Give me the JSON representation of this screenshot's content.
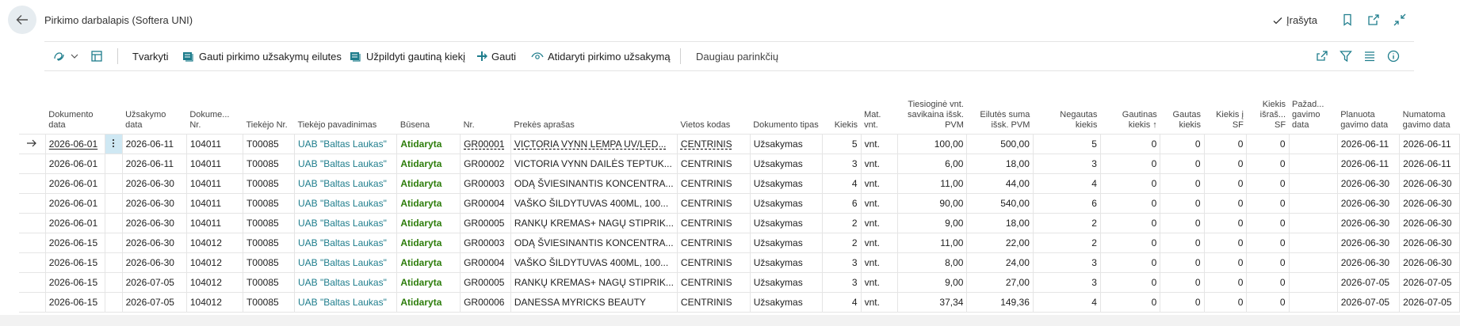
{
  "header": {
    "title": "Pirkimo darbalapis (Softera UNI)",
    "saved_label": "Įrašyta"
  },
  "toolbar": {
    "actions": [
      "Tvarkyti",
      "Gauti pirkimo užsakymų eilutes",
      "Užpildyti gautiną kiekį",
      "Gauti",
      "Atidaryti pirkimo užsakymą",
      "Daugiau parinkčių"
    ]
  },
  "columns": [
    "Dokumento data",
    "Užsakymo data",
    "Dokume... Nr.",
    "Tiekėjo Nr.",
    "Tiekėjo pavadinimas",
    "Būsena",
    "Nr.",
    "Prekės aprašas",
    "Vietos kodas",
    "Dokumento tipas",
    "Kiekis",
    "Mat. vnt.",
    "Tiesioginė vnt. savikaina išsk. PVM",
    "Eilutės suma išsk. PVM",
    "Negautas kiekis",
    "Gautinas kiekis ↑",
    "Gautas kiekis",
    "Kiekis į SF",
    "Kiekis išraš... SF",
    "Pažad... gavimo data",
    "Planuota gavimo data",
    "Numatoma gavimo data"
  ],
  "rows": [
    [
      "2026-06-01",
      "2026-06-11",
      "104011",
      "T00085",
      "UAB \"Baltas Laukas\"",
      "Atidaryta",
      "GR00001",
      "VICTORIA VYNN LEMPA UV/LED...",
      "CENTRINIS",
      "Užsakymas",
      "5",
      "vnt.",
      "100,00",
      "500,00",
      "5",
      "0",
      "0",
      "0",
      "0",
      "",
      "2026-06-11",
      "2026-06-11"
    ],
    [
      "2026-06-01",
      "2026-06-11",
      "104011",
      "T00085",
      "UAB \"Baltas Laukas\"",
      "Atidaryta",
      "GR00002",
      "VICTORIA VYNN DAILĖS TEPTUK...",
      "CENTRINIS",
      "Užsakymas",
      "3",
      "vnt.",
      "6,00",
      "18,00",
      "3",
      "0",
      "0",
      "0",
      "0",
      "",
      "2026-06-11",
      "2026-06-11"
    ],
    [
      "2026-06-01",
      "2026-06-30",
      "104011",
      "T00085",
      "UAB \"Baltas Laukas\"",
      "Atidaryta",
      "GR00003",
      "ODĄ ŠVIESINANTIS KONCENTRA...",
      "CENTRINIS",
      "Užsakymas",
      "4",
      "vnt.",
      "11,00",
      "44,00",
      "4",
      "0",
      "0",
      "0",
      "0",
      "",
      "2026-06-30",
      "2026-06-30"
    ],
    [
      "2026-06-01",
      "2026-06-30",
      "104011",
      "T00085",
      "UAB \"Baltas Laukas\"",
      "Atidaryta",
      "GR00004",
      "VAŠKO ŠILDYTUVAS 400ML, 100...",
      "CENTRINIS",
      "Užsakymas",
      "6",
      "vnt.",
      "90,00",
      "540,00",
      "6",
      "0",
      "0",
      "0",
      "0",
      "",
      "2026-06-30",
      "2026-06-30"
    ],
    [
      "2026-06-01",
      "2026-06-30",
      "104011",
      "T00085",
      "UAB \"Baltas Laukas\"",
      "Atidaryta",
      "GR00005",
      "RANKŲ KREMAS+ NAGŲ STIPRIK...",
      "CENTRINIS",
      "Užsakymas",
      "2",
      "vnt.",
      "9,00",
      "18,00",
      "2",
      "0",
      "0",
      "0",
      "0",
      "",
      "2026-06-30",
      "2026-06-30"
    ],
    [
      "2026-06-15",
      "2026-06-30",
      "104012",
      "T00085",
      "UAB \"Baltas Laukas\"",
      "Atidaryta",
      "GR00003",
      "ODĄ ŠVIESINANTIS KONCENTRA...",
      "CENTRINIS",
      "Užsakymas",
      "2",
      "vnt.",
      "11,00",
      "22,00",
      "2",
      "0",
      "0",
      "0",
      "0",
      "",
      "2026-06-30",
      "2026-06-30"
    ],
    [
      "2026-06-15",
      "2026-06-30",
      "104012",
      "T00085",
      "UAB \"Baltas Laukas\"",
      "Atidaryta",
      "GR00004",
      "VAŠKO ŠILDYTUVAS 400ML, 100...",
      "CENTRINIS",
      "Užsakymas",
      "3",
      "vnt.",
      "8,00",
      "24,00",
      "3",
      "0",
      "0",
      "0",
      "0",
      "",
      "2026-06-30",
      "2026-06-30"
    ],
    [
      "2026-06-15",
      "2026-07-05",
      "104012",
      "T00085",
      "UAB \"Baltas Laukas\"",
      "Atidaryta",
      "GR00005",
      "RANKŲ KREMAS+ NAGŲ STIPRIK...",
      "CENTRINIS",
      "Užsakymas",
      "3",
      "vnt.",
      "9,00",
      "27,00",
      "3",
      "0",
      "0",
      "0",
      "0",
      "",
      "2026-07-05",
      "2026-07-05"
    ],
    [
      "2026-06-15",
      "2026-07-05",
      "104012",
      "T00085",
      "UAB \"Baltas Laukas\"",
      "Atidaryta",
      "GR00006",
      "DANESSA MYRICKS BEAUTY",
      "CENTRINIS",
      "Užsakymas",
      "4",
      "vnt.",
      "37,34",
      "149,36",
      "4",
      "0",
      "0",
      "0",
      "0",
      "",
      "2026-07-05",
      "2026-07-05"
    ]
  ],
  "icons": {
    "back": "arrow-left-icon",
    "saved": "checkmark-icon",
    "bookmark": "bookmark-icon",
    "open_new": "open-in-new-window-icon",
    "collapse": "collapse-icon",
    "share": "share-icon",
    "filter": "filter-icon",
    "list": "list-icon",
    "info": "info-icon",
    "row_arrow": "current-row-arrow-icon",
    "row_menu": "row-menu-icon"
  },
  "colors": {
    "accent": "#1e7d8c",
    "status": "#2d7d0b",
    "selected_cell": "#cfe8f3"
  }
}
